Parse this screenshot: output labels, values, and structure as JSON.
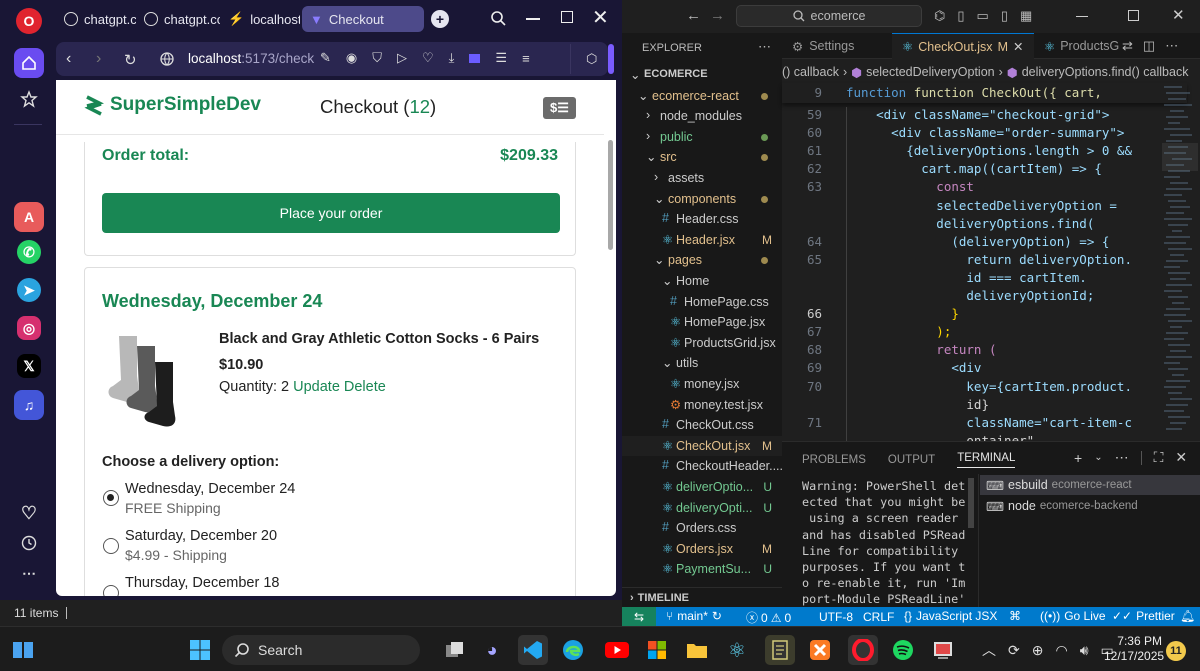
{
  "browser": {
    "tabs": [
      {
        "label": "chatgpt.co"
      },
      {
        "label": "chatgpt.co"
      },
      {
        "label": "localhost"
      },
      {
        "label": "Checkout"
      }
    ],
    "address": {
      "host": "localhost",
      "path": ":5173/check"
    },
    "sidebar_icons": [
      "opera-logo-icon",
      "home-icon",
      "star-icon",
      "aria-icon",
      "whatsapp-icon",
      "telegram-icon",
      "instagram-icon",
      "x-icon",
      "music-icon",
      "heart-icon",
      "history-icon",
      "more-icon"
    ]
  },
  "checkout": {
    "brand": "SuperSimpleDev",
    "title": "Checkout",
    "item_count_open": "(",
    "item_count": "12",
    "item_count_close": ")",
    "order_total_label": "Order total:",
    "order_total_value": "$209.33",
    "place_order_label": "Place your order",
    "delivery_date": "Wednesday, December 24",
    "product": {
      "name": "Black and Gray Athletic Cotton Socks - 6 Pairs",
      "price": "$10.90",
      "quantity_label": "Quantity: 2",
      "update_label": "Update",
      "delete_label": "Delete"
    },
    "delivery_heading": "Choose a delivery option:",
    "options": [
      {
        "date": "Wednesday, December 24",
        "price": "FREE Shipping",
        "selected": true
      },
      {
        "date": "Saturday, December 20",
        "price": "$4.99 - Shipping",
        "selected": false
      },
      {
        "date": "Thursday, December 18",
        "price": "",
        "selected": false
      }
    ]
  },
  "below_bar": {
    "items_label": "11 items"
  },
  "vscode": {
    "search_placeholder": "ecomerce",
    "explorer_title": "EXPLORER",
    "tabs": [
      {
        "label": "Settings"
      },
      {
        "label": "CheckOut.jsx",
        "modified": "M"
      },
      {
        "label": "ProductsG"
      }
    ],
    "breadcrumb": {
      "part1": "() callback",
      "part2": "selectedDeliveryOption",
      "part3": "deliveryOptions.find() callback"
    },
    "tree": [
      {
        "label": "ECOMERCE",
        "indent": 0,
        "kind": "root"
      },
      {
        "label": "ecomerce-react",
        "indent": 1,
        "kind": "folder",
        "dot": "y"
      },
      {
        "label": "node_modules",
        "indent": 2,
        "kind": "folder-closed"
      },
      {
        "label": "public",
        "indent": 2,
        "kind": "folder-closed",
        "dot": "g"
      },
      {
        "label": "src",
        "indent": 2,
        "kind": "folder",
        "dot": "y"
      },
      {
        "label": "assets",
        "indent": 3,
        "kind": "folder-closed"
      },
      {
        "label": "components",
        "indent": 3,
        "kind": "folder",
        "dot": "y"
      },
      {
        "label": "Header.css",
        "indent": 4,
        "kind": "css"
      },
      {
        "label": "Header.jsx",
        "indent": 4,
        "kind": "jsx",
        "badge": "M"
      },
      {
        "label": "pages",
        "indent": 3,
        "kind": "folder",
        "dot": "y"
      },
      {
        "label": "Home",
        "indent": 4,
        "kind": "folder"
      },
      {
        "label": "HomePage.css",
        "indent": 5,
        "kind": "css"
      },
      {
        "label": "HomePage.jsx",
        "indent": 5,
        "kind": "jsx"
      },
      {
        "label": "ProductsGrid.jsx",
        "indent": 5,
        "kind": "jsx"
      },
      {
        "label": "utils",
        "indent": 4,
        "kind": "folder"
      },
      {
        "label": "money.jsx",
        "indent": 5,
        "kind": "jsx"
      },
      {
        "label": "money.test.jsx",
        "indent": 5,
        "kind": "test"
      },
      {
        "label": "CheckOut.css",
        "indent": 4,
        "kind": "css"
      },
      {
        "label": "CheckOut.jsx",
        "indent": 4,
        "kind": "jsx",
        "badge": "M"
      },
      {
        "label": "CheckoutHeader....",
        "indent": 4,
        "kind": "css"
      },
      {
        "label": "deliverOptio...",
        "indent": 4,
        "kind": "jsx",
        "badge": "U"
      },
      {
        "label": "deliveryOpti...",
        "indent": 4,
        "kind": "jsx",
        "badge": "U"
      },
      {
        "label": "Orders.css",
        "indent": 4,
        "kind": "css"
      },
      {
        "label": "Orders.jsx",
        "indent": 4,
        "kind": "jsx",
        "badge": "M"
      },
      {
        "label": "PaymentSu...",
        "indent": 4,
        "kind": "jsx",
        "badge": "U"
      }
    ],
    "timeline_label": "TIMELINE",
    "code_header": {
      "num": "9",
      "text": "function CheckOut({ cart,"
    },
    "code_lines": [
      {
        "num": "59",
        "text": "    <div className=\"checkout-grid\">"
      },
      {
        "num": "60",
        "text": "      <div className=\"order-summary\">"
      },
      {
        "num": "61",
        "text": "        {deliveryOptions.length > 0 &&"
      },
      {
        "num": "62",
        "text": "          cart.map((cartItem) => {"
      },
      {
        "num": "63",
        "text": "            const"
      },
      {
        "num": "",
        "text": "            selectedDeliveryOption ="
      },
      {
        "num": "",
        "text": "            deliveryOptions.find("
      },
      {
        "num": "64",
        "text": "              (deliveryOption) => {"
      },
      {
        "num": "65",
        "text": "                return deliveryOption."
      },
      {
        "num": "",
        "text": "                id === cartItem."
      },
      {
        "num": "",
        "text": "                deliveryOptionId;"
      },
      {
        "num": "66",
        "text": "              }"
      },
      {
        "num": "67",
        "text": "            );"
      },
      {
        "num": "68",
        "text": "            return ("
      },
      {
        "num": "69",
        "text": "              <div"
      },
      {
        "num": "70",
        "text": "                key={cartItem.product."
      },
      {
        "num": "",
        "text": "                id}"
      },
      {
        "num": "71",
        "text": "                className=\"cart-item-c"
      },
      {
        "num": "",
        "text": "                ontainer\""
      }
    ],
    "panel_tabs": [
      "PROBLEMS",
      "OUTPUT",
      "TERMINAL"
    ],
    "terminal_lines": [
      "Warning: PowerShell det",
      "ected that you might be",
      " using a screen reader",
      "and has disabled PSRead",
      "Line for compatibility",
      "purposes. If you want t",
      "o re-enable it, run 'Im",
      "port-Module PSReadLine'"
    ],
    "terminals": [
      {
        "name": "esbuild",
        "folder": "ecomerce-react"
      },
      {
        "name": "node",
        "folder": "ecomerce-backend"
      }
    ],
    "status": {
      "branch": "main*",
      "errors": "0",
      "warnings": "0",
      "encoding": "UTF-8",
      "eol": "CRLF",
      "language": "JavaScript JSX",
      "golive": "Go Live",
      "prettier": "Prettier"
    }
  },
  "taskbar": {
    "search_label": "Search",
    "time": "7:36 PM",
    "date": "12/17/2025",
    "notifications": "11"
  }
}
